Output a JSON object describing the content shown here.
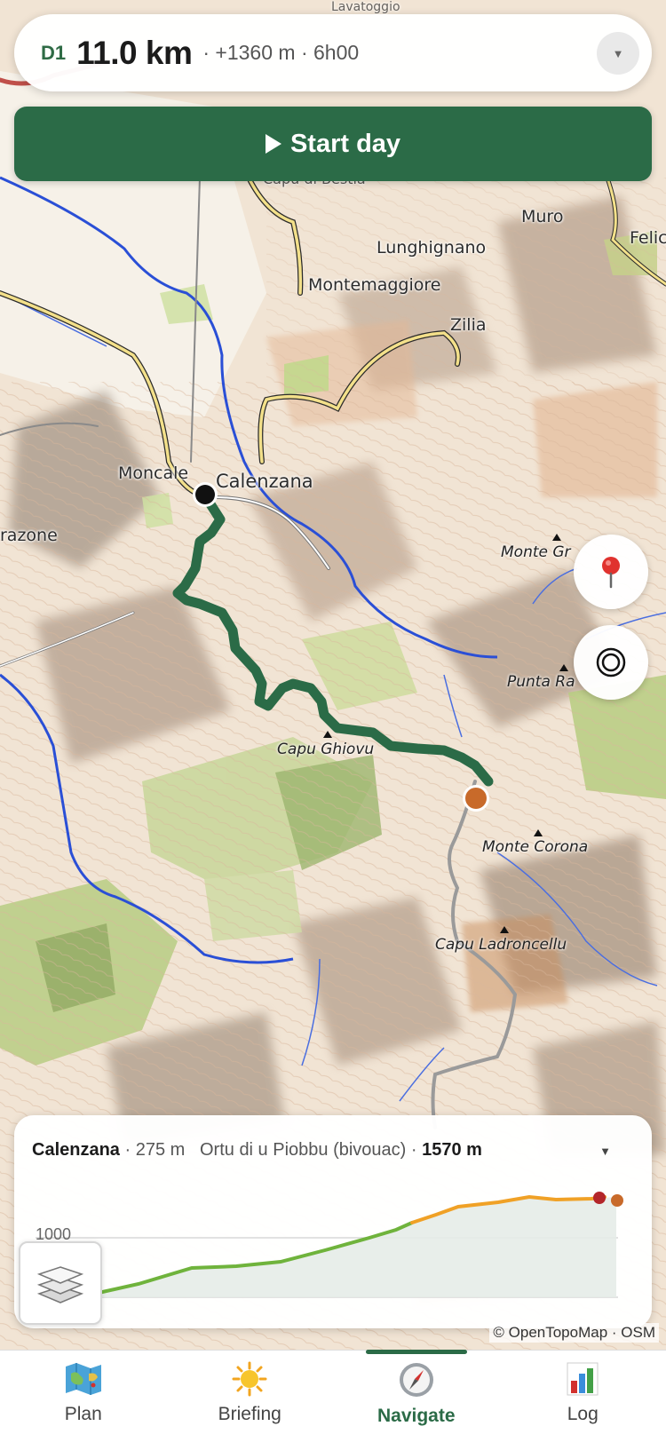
{
  "summary": {
    "day": "D1",
    "distance": "11.0 km",
    "stats": "· +1360 m · 6h00",
    "toggle_icon": "chevron-down-icon"
  },
  "start_button": {
    "label": "Start day",
    "icon": "play-icon"
  },
  "map": {
    "places": [
      "Lunghignano",
      "Montemaggiore",
      "Zilia",
      "Muro",
      "Felic",
      "Moncale",
      "Calenzana",
      "razone",
      "Capu di Bestia",
      "Lavatoggio"
    ],
    "peaks": [
      "Monte Gr",
      "Punta Ra",
      "Capu Ghiovu",
      "Monte Corona",
      "Capu Ladroncellu"
    ],
    "route_color": "#2b6b47",
    "start_marker_color": "#111111",
    "end_marker_color": "#c86a2a",
    "controls": {
      "pin_icon": "map-pin-icon",
      "locate_icon": "locate-icon"
    },
    "attribution": "© OpenTopoMap · OSM"
  },
  "elevation": {
    "start_name": "Calenzana",
    "start_alt": "· 275 m",
    "end_name": "Ortu di u Piobbu (bivouac)",
    "end_sep": "·",
    "end_alt": "1570 m",
    "toggle_icon": "chevron-down-icon",
    "axis_label": "1000",
    "colors": {
      "low": "#6fb33c",
      "high": "#f0a126",
      "end_dot": "#c86a2a",
      "current_dot": "#b3262a"
    }
  },
  "layers_button": {
    "icon": "layers-icon"
  },
  "tabs": [
    {
      "label": "Plan",
      "icon": "map-icon",
      "active": false
    },
    {
      "label": "Briefing",
      "icon": "sun-icon",
      "active": false
    },
    {
      "label": "Navigate",
      "icon": "compass-icon",
      "active": true
    },
    {
      "label": "Log",
      "icon": "bar-chart-icon",
      "active": false
    }
  ]
}
